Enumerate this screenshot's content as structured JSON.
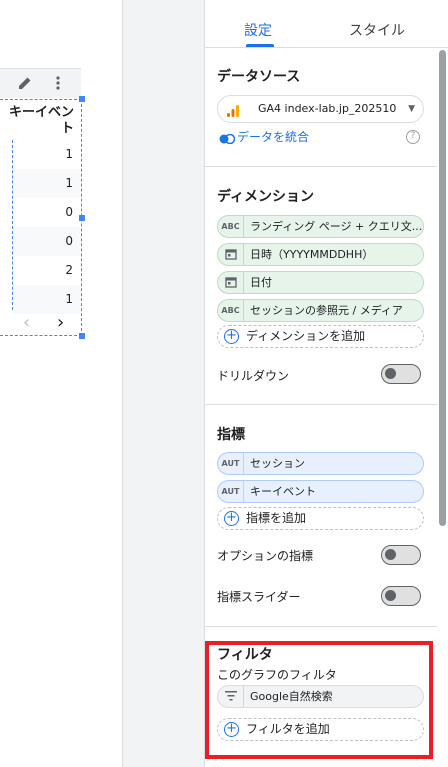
{
  "table": {
    "header": "キーイベント",
    "rows": [
      "1",
      "1",
      "0",
      "0",
      "2",
      "1"
    ],
    "pager_prev": "‹",
    "pager_next": "›"
  },
  "panel": {
    "tabs": [
      {
        "label": "設定"
      },
      {
        "label": "スタイル"
      }
    ],
    "datasource": {
      "title": "データソース",
      "selected": "GA4 index-lab.jp_202510",
      "blend_link": "データを統合",
      "help": "?"
    },
    "dimension": {
      "title": "ディメンション",
      "chips": [
        {
          "type": "ABC",
          "label": "ランディング ページ + クエリ文..."
        },
        {
          "type": "cal",
          "label": "日時（YYYYMMDDHH）"
        },
        {
          "type": "cal",
          "label": "日付"
        },
        {
          "type": "ABC",
          "label": "セッションの参照元 / メディア"
        }
      ],
      "add_label": "ディメンションを追加",
      "drilldown_label": "ドリルダウン"
    },
    "metric": {
      "title": "指標",
      "chips": [
        {
          "type": "AUT",
          "label": "セッション"
        },
        {
          "type": "AUT",
          "label": "キーイベント"
        }
      ],
      "add_label": "指標を追加",
      "optional_label": "オプションの指標",
      "slider_label": "指標スライダー"
    },
    "filter": {
      "title": "フィルタ",
      "subtitle": "このグラフのフィルタ",
      "chip_label": "Google自然検索",
      "add_label": "フィルタを追加"
    }
  },
  "colors": {
    "accent": "#1a73e8",
    "highlight": "#ee1c24",
    "dimension_chip": "#e6f4ea",
    "metric_chip": "#e8f0fe"
  }
}
